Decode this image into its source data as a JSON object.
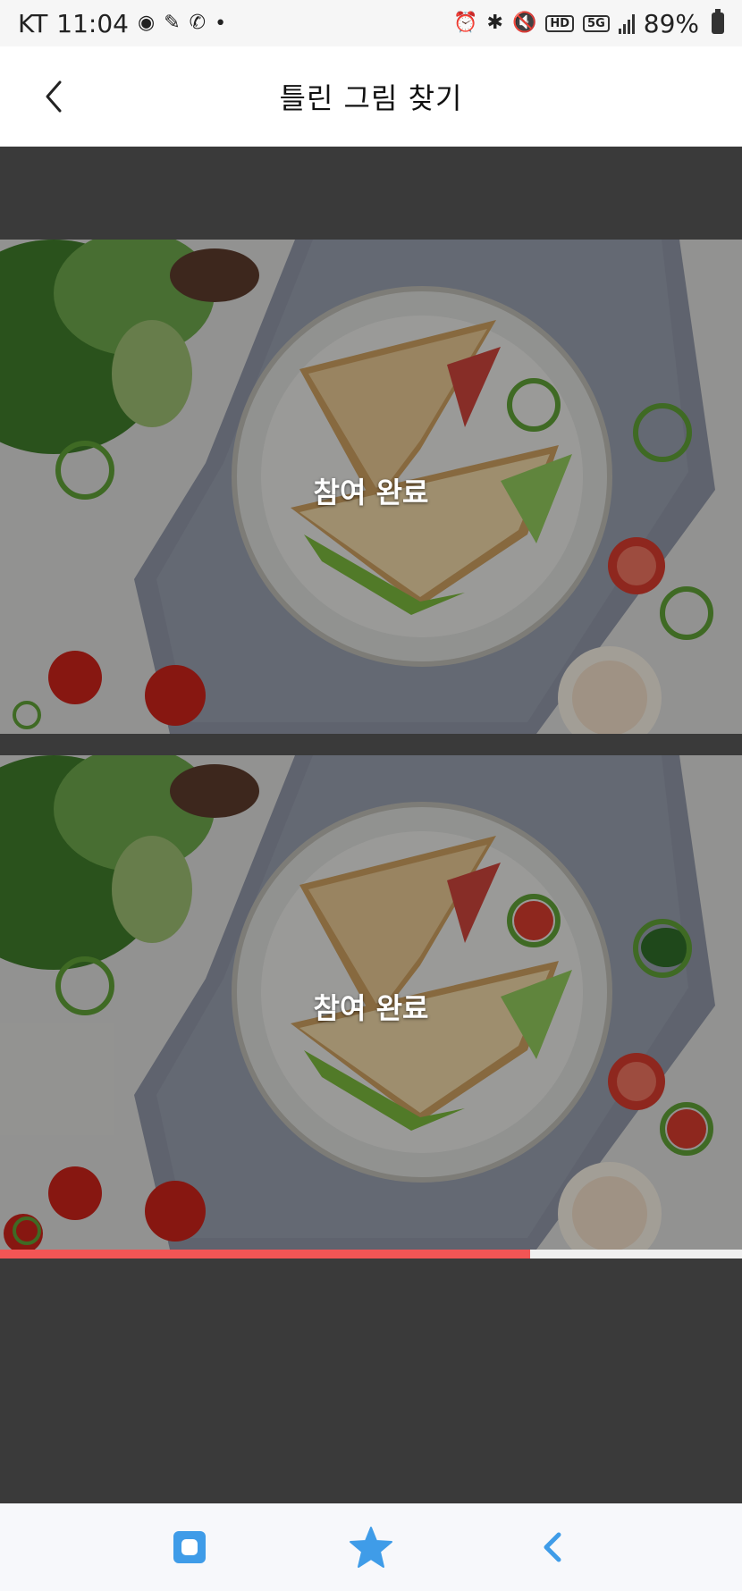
{
  "status_bar": {
    "carrier": "KT",
    "time": "11:04",
    "battery": "89%",
    "network": "5G",
    "hd_badge": "HD",
    "left_icons": [
      "record-icon",
      "app-icon",
      "call-icon",
      "dot-icon"
    ],
    "right_icons": [
      "alarm-icon",
      "bluetooth-icon",
      "mute-icon",
      "hd-icon",
      "5g-icon",
      "signal-icon",
      "battery-icon"
    ]
  },
  "header": {
    "title": "틀린 그림 찾기",
    "back_icon": "back-chevron-icon"
  },
  "game": {
    "top_puzzle": {
      "status_text": "참여 완료"
    },
    "bottom_puzzle": {
      "status_text": "참여 완료"
    },
    "progress_fraction": 0.715,
    "found_marker_color": "#5d9c35",
    "progress_color": "#f25555"
  },
  "bottom_nav": {
    "items": [
      {
        "icon": "home-square-icon"
      },
      {
        "icon": "star-icon"
      },
      {
        "icon": "back-chevron-icon"
      }
    ],
    "accent": "#3f9ce8"
  }
}
